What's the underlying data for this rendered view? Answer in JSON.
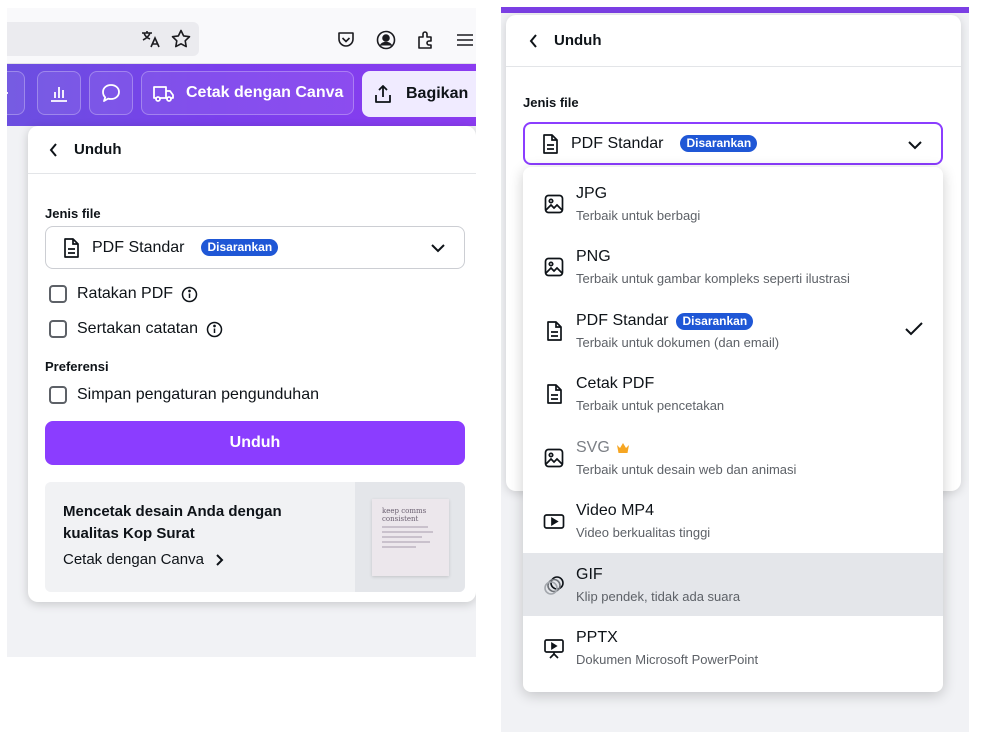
{
  "left": {
    "toolbar": {
      "translate_icon": "translate-icon",
      "star_icon": "star-icon",
      "pocket_icon": "pocket-icon",
      "account_icon": "account-icon",
      "extensions_icon": "extensions-icon",
      "menu_icon": "hamburger-icon"
    },
    "canva_bar": {
      "print_label": "Cetak dengan Canva",
      "share_label": "Bagikan"
    },
    "download_card": {
      "title": "Unduh",
      "file_type_label": "Jenis file",
      "selected_type": "PDF Standar",
      "selected_badge": "Disarankan",
      "options": [
        {
          "label": "Ratakan PDF",
          "checked": false
        },
        {
          "label": "Sertakan catatan",
          "checked": false
        }
      ],
      "preferences_label": "Preferensi",
      "preference_option": {
        "label": "Simpan pengaturan pengunduhan",
        "checked": false
      },
      "download_button": "Unduh",
      "promo": {
        "text": "Mencetak desain Anda dengan kualitas Kop Surat",
        "link": "Cetak dengan Canva",
        "thumb_text": "keep comms consistent"
      }
    }
  },
  "right": {
    "download_card": {
      "title": "Unduh",
      "file_type_label": "Jenis file",
      "selected_type": "PDF Standar",
      "selected_badge": "Disarankan"
    },
    "file_types": [
      {
        "title": "JPG",
        "subtitle": "Terbaik untuk berbagi",
        "icon": "image-icon"
      },
      {
        "title": "PNG",
        "subtitle": "Terbaik untuk gambar kompleks seperti ilustrasi",
        "icon": "image-icon"
      },
      {
        "title": "PDF Standar",
        "badge": "Disarankan",
        "subtitle": "Terbaik untuk dokumen (dan email)",
        "icon": "document-icon",
        "selected": true
      },
      {
        "title": "Cetak PDF",
        "subtitle": "Terbaik untuk pencetakan",
        "icon": "document-icon"
      },
      {
        "title": "SVG",
        "subtitle": "Terbaik untuk desain web dan animasi",
        "icon": "image-icon",
        "premium": true
      },
      {
        "title": "Video MP4",
        "subtitle": "Video berkualitas tinggi",
        "icon": "video-icon"
      },
      {
        "title": "GIF",
        "subtitle": "Klip pendek, tidak ada suara",
        "icon": "gif-icon",
        "highlighted": true
      },
      {
        "title": "PPTX",
        "subtitle": "Dokumen Microsoft PowerPoint",
        "icon": "presentation-icon"
      }
    ],
    "colors": {
      "accent": "#8b3dff",
      "badge": "#1f57d6",
      "crown": "#f6a623"
    }
  }
}
